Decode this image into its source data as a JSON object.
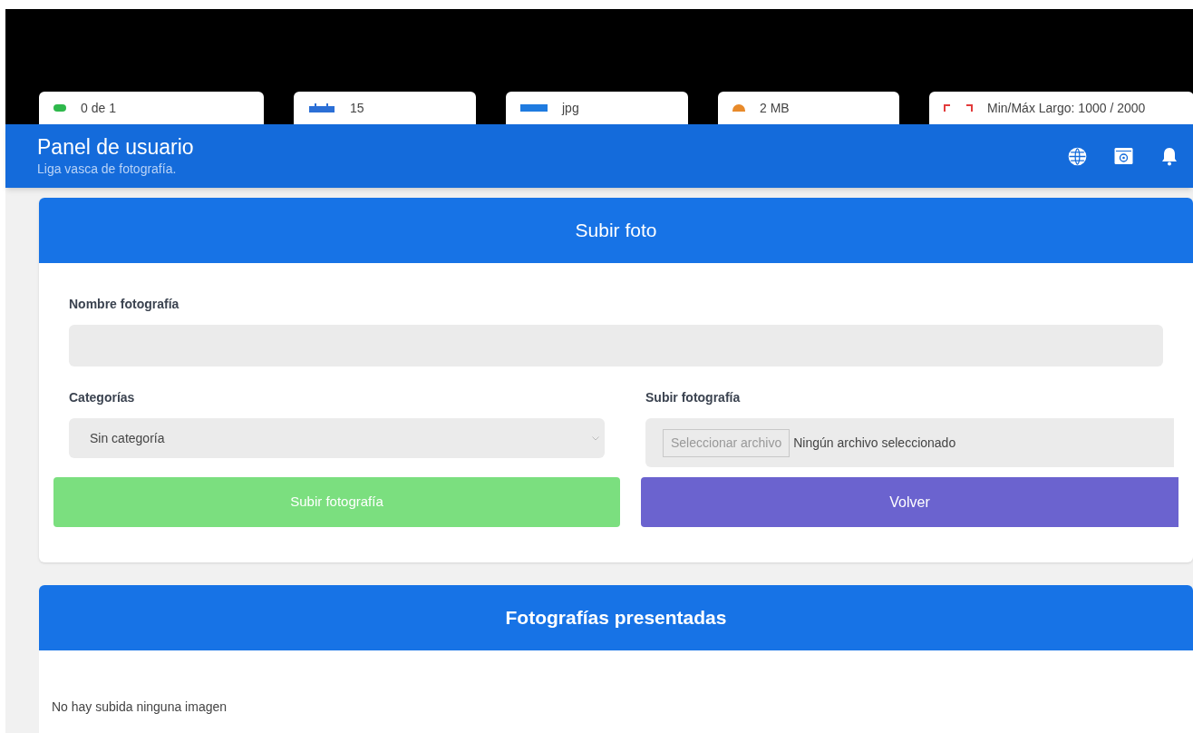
{
  "stats": [
    {
      "kind": "square",
      "text": "0 de 1"
    },
    {
      "kind": "calendar",
      "text": "15"
    },
    {
      "kind": "file",
      "text": "jpg"
    },
    {
      "kind": "circle",
      "text": "2 MB"
    },
    {
      "kind": "expand",
      "text": "Min/Máx Largo: 1000 / 2000"
    }
  ],
  "header": {
    "title": "Panel de usuario",
    "subtitle": "Liga vasca de fotografía."
  },
  "upload": {
    "title": "Subir foto",
    "name_label": "Nombre fotografía",
    "category_label": "Categorías",
    "category_value": "Sin categoría",
    "file_label": "Subir fotografía",
    "file_button": "Seleccionar archivo",
    "file_status": "Ningún archivo seleccionado",
    "submit": "Subir fotografía",
    "back": "Volver"
  },
  "presented": {
    "title": "Fotografías presentadas",
    "empty": "No hay subida ninguna imagen"
  }
}
